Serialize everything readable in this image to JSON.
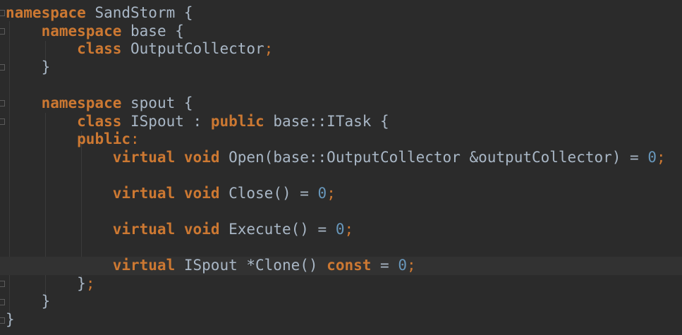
{
  "colors": {
    "background": "#2b2b2b",
    "keyword": "#cc7832",
    "identifier": "#a9b7c6",
    "number": "#6897bb",
    "current_line": "#323232"
  },
  "code": {
    "l1": {
      "kw": "namespace",
      "rest": " SandStorm {"
    },
    "l2": {
      "kw": "namespace",
      "rest": " base {"
    },
    "l3": {
      "kw": "class",
      "name": " OutputCollector",
      "semi": ";"
    },
    "l4": {
      "rest": "}"
    },
    "l6": {
      "kw": "namespace",
      "rest": " spout {"
    },
    "l7": {
      "kw1": "class",
      "mid": " ISpout : ",
      "kw2": "public",
      "rest": " base::ITask {"
    },
    "l8": {
      "kw": "public",
      "rest": ":"
    },
    "l9": {
      "kw1": "virtual",
      "kw2": "void",
      "mid": " Open(base::OutputCollector &outputCollector) = ",
      "num": "0",
      "semi": ";"
    },
    "l11": {
      "kw1": "virtual",
      "kw2": "void",
      "mid": " Close() = ",
      "num": "0",
      "semi": ";"
    },
    "l13": {
      "kw1": "virtual",
      "kw2": "void",
      "mid": " Execute() = ",
      "num": "0",
      "semi": ";"
    },
    "l15": {
      "kw1": "virtual",
      "mid": " ISpout *Clone() ",
      "kw2": "const",
      "eq": " = ",
      "num": "0",
      "semi": ";"
    },
    "l16": {
      "rest": "}",
      "semi": ";"
    },
    "l17": {
      "rest": "}"
    },
    "l18": {
      "rest": "}"
    }
  }
}
